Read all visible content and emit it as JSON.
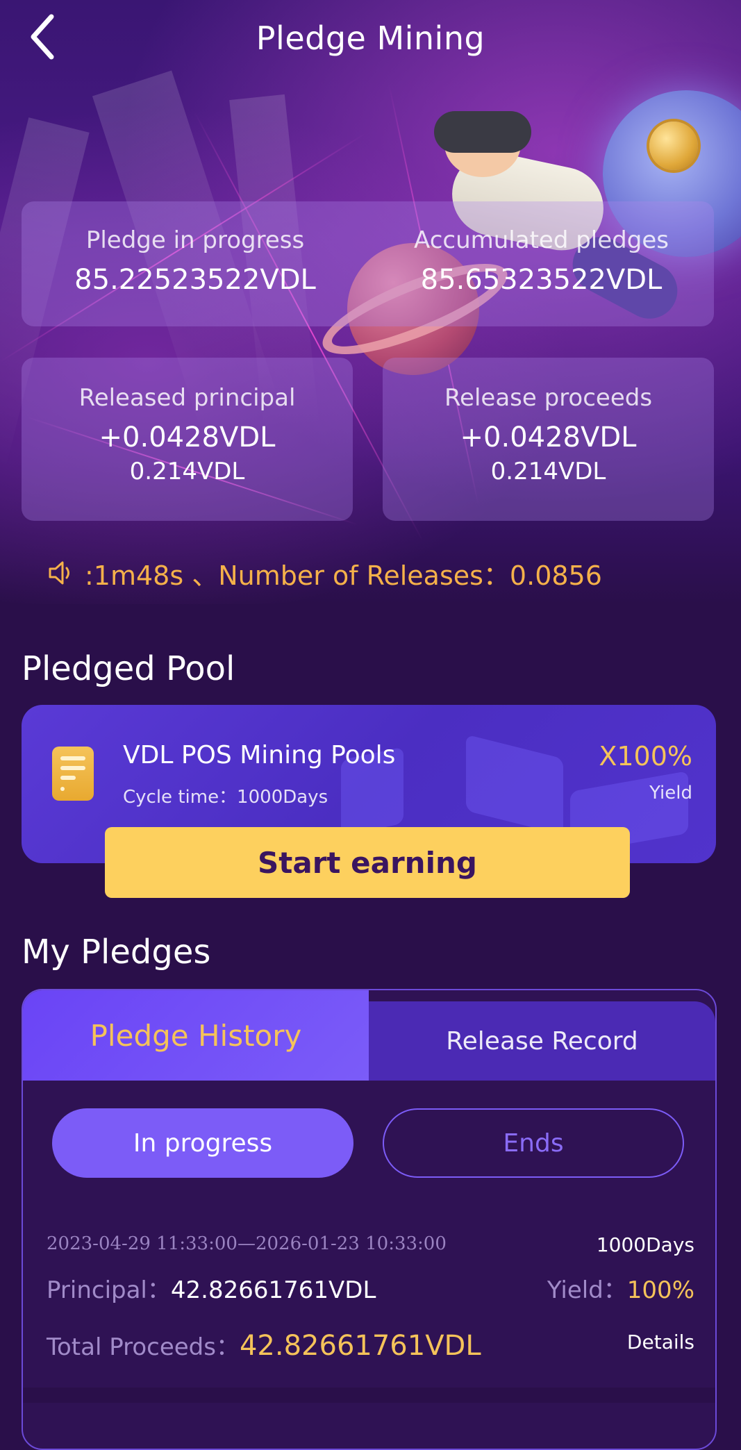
{
  "header": {
    "title": "Pledge Mining",
    "back_icon": "chevron-left-icon"
  },
  "stats": {
    "pledge_in_progress": {
      "label": "Pledge in progress",
      "value": "85.22523522VDL"
    },
    "accumulated_pledges": {
      "label": "Accumulated pledges",
      "value": "85.65323522VDL"
    },
    "released_principal": {
      "label": "Released principal",
      "value": "+0.0428VDL",
      "sub": "0.214VDL"
    },
    "release_proceeds": {
      "label": "Release proceeds",
      "value": "+0.0428VDL",
      "sub": "0.214VDL"
    }
  },
  "ticker": {
    "icon": "speaker-icon",
    "text": ":1m48s 、Number of Releases：0.0856"
  },
  "pledged_pool": {
    "section_title": "Pledged Pool",
    "name": "VDL POS Mining Pools",
    "cycle": "Cycle time：1000Days",
    "yield_value": "X100%",
    "yield_label": "Yield",
    "start_button": "Start earning"
  },
  "my_pledges": {
    "section_title": "My Pledges",
    "tabs": {
      "history": "Pledge History",
      "release": "Release Record"
    },
    "filters": {
      "in_progress": "In progress",
      "ends": "Ends"
    },
    "records": [
      {
        "dates": "2023-04-29 11:33:00—2026-01-23 10:33:00",
        "days": "1000Days",
        "principal_label": "Principal：",
        "principal_value": "42.82661761VDL",
        "yield_label": "Yield：",
        "yield_value": "100%",
        "total_label": "Total Proceeds：",
        "total_value": "42.82661761VDL",
        "details": "Details"
      }
    ]
  },
  "colors": {
    "accent_gold": "#f5c35a",
    "accent_purple": "#7c5cf7",
    "button_yellow": "#fdd05e",
    "background": "#2a0f4a"
  }
}
